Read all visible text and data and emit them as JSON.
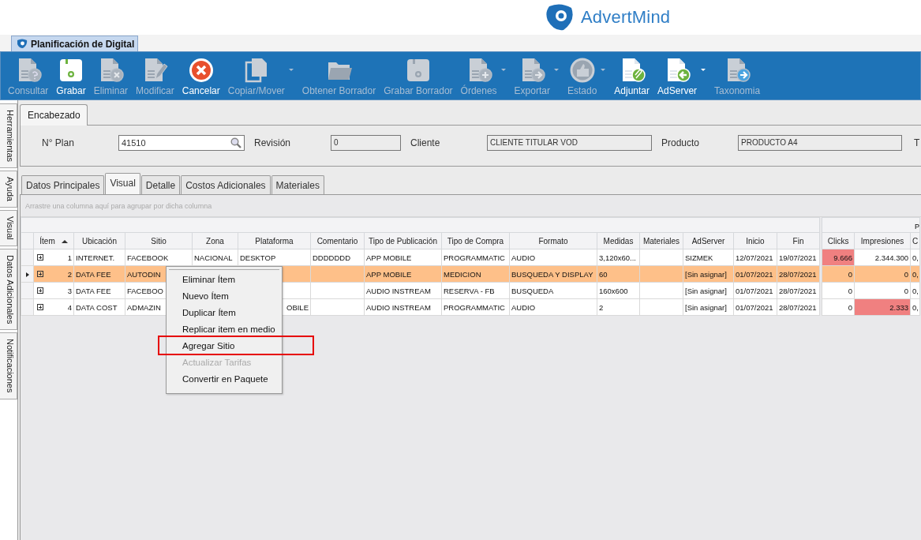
{
  "app": {
    "brand": "AdvertMind"
  },
  "document_tab": {
    "title": "Planificación de Digital",
    "selected": true
  },
  "toolbar": [
    {
      "label": "Consultar",
      "kind": "doc-question",
      "disabled": true,
      "dropdown": false
    },
    {
      "label": "Grabar",
      "kind": "floppy-green",
      "disabled": false,
      "dropdown": false
    },
    {
      "label": "Eliminar",
      "kind": "doc-x",
      "disabled": true,
      "dropdown": false
    },
    {
      "label": "Modificar",
      "kind": "doc-pencil",
      "disabled": true,
      "dropdown": false
    },
    {
      "label": "Cancelar",
      "kind": "cancel",
      "disabled": false,
      "dropdown": false
    },
    {
      "label": "Copiar/Mover",
      "kind": "copy",
      "disabled": true,
      "dropdown": true
    },
    {
      "label": "Obtener Borrador",
      "kind": "folder",
      "disabled": true,
      "dropdown": false
    },
    {
      "label": "Grabar Borrador",
      "kind": "floppy",
      "disabled": true,
      "dropdown": false
    },
    {
      "label": "Órdenes",
      "kind": "doc-plus",
      "disabled": true,
      "dropdown": true
    },
    {
      "label": "Exportar",
      "kind": "doc-arrow",
      "disabled": true,
      "dropdown": true
    },
    {
      "label": "Estado",
      "kind": "thumb",
      "disabled": true,
      "dropdown": true
    },
    {
      "label": "Adjuntar",
      "kind": "doc-clip",
      "disabled": false,
      "dropdown": false
    },
    {
      "label": "AdServer",
      "kind": "doc-back",
      "disabled": false,
      "dropdown": true
    },
    {
      "label": "Taxonomia",
      "kind": "doc-blue",
      "disabled": true,
      "dropdown": false
    }
  ],
  "side_tabs": [
    {
      "label": "Herramientas",
      "selected": false
    },
    {
      "label": "Ayuda",
      "selected": false
    },
    {
      "label": "Visual",
      "selected": false
    },
    {
      "label": "Datos Adicionales",
      "selected": false
    },
    {
      "label": "Notificaciones",
      "selected": false
    }
  ],
  "header": {
    "tab": "Encabezado",
    "fields": [
      {
        "label": "N° Plan",
        "value": "41510",
        "kind": "search"
      },
      {
        "label": "Revisión",
        "value": "0",
        "kind": "readonly"
      },
      {
        "label": "Cliente",
        "value": "CLIENTE TITULAR VOD",
        "kind": "readonly"
      },
      {
        "label": "Producto",
        "value": "PRODUCTO A4",
        "kind": "readonly"
      },
      {
        "label": "T",
        "kind": "cut"
      }
    ]
  },
  "tabs": [
    {
      "label": "Datos Principales",
      "selected": false
    },
    {
      "label": "Visual",
      "selected": true
    },
    {
      "label": "Detalle",
      "selected": false
    },
    {
      "label": "Costos Adicionales",
      "selected": false
    },
    {
      "label": "Materiales",
      "selected": false
    }
  ],
  "grid": {
    "group_hint": "Arrastre una columna aquí para agrupar por dicha columna",
    "band": "P",
    "columns": [
      "Ítem",
      "Ubicación",
      "Sitio",
      "Zona",
      "Plataforma",
      "Comentario",
      "Tipo de Publicación",
      "Tipo de Compra",
      "Formato",
      "Medidas",
      "Materiales",
      "AdServer",
      "Inicio",
      "Fin",
      "Clicks",
      "Impresiones",
      "C"
    ],
    "sorted_ascending": true,
    "rows": [
      {
        "selected": false,
        "cells": [
          "1",
          "INTERNET.",
          "FACEBOOK",
          "NACIONAL",
          "DESKTOP",
          "DDDDDDD",
          "APP MOBILE",
          "PROGRAMMATIC",
          "AUDIO",
          "3,120x60...",
          null,
          "SIZMEK",
          "12/07/2021",
          "19/07/2021",
          {
            "text": "9.666",
            "alert": true
          },
          "2.344.300",
          "0,"
        ]
      },
      {
        "selected": true,
        "cells": [
          "2",
          "DATA FEE",
          "AUTODIN",
          null,
          null,
          null,
          "APP MOBILE",
          "MEDICION",
          "BUSQUEDA Y DISPLAY",
          "60",
          null,
          "[Sin asignar]",
          "01/07/2021",
          "28/07/2021",
          "0",
          "0",
          "0,"
        ]
      },
      {
        "selected": false,
        "cells": [
          "3",
          "DATA FEE",
          "FACEBOO",
          null,
          null,
          null,
          "AUDIO INSTREAM",
          "RESERVA - FB",
          "BUSQUEDA",
          "160x600",
          null,
          "[Sin asignar]",
          "01/07/2021",
          "28/07/2021",
          "0",
          "0",
          "0,"
        ]
      },
      {
        "selected": false,
        "cells": [
          "4",
          "DATA COST",
          "ADMAZIN",
          null,
          {
            "text": "OBILE",
            "cut": true
          },
          null,
          "AUDIO INSTREAM",
          "PROGRAMMATIC",
          "AUDIO",
          "2",
          null,
          "[Sin asignar]",
          "01/07/2021",
          "28/07/2021",
          "0",
          {
            "text": "2.333",
            "alert": true
          },
          "0,"
        ]
      }
    ]
  },
  "context_menu": [
    {
      "label": "Eliminar Ítem",
      "disabled": false,
      "highlighted": false
    },
    {
      "label": "Nuevo Ítem",
      "disabled": false,
      "highlighted": false
    },
    {
      "label": "Duplicar Ítem",
      "disabled": false,
      "highlighted": false
    },
    {
      "label": "Replicar item en medio",
      "disabled": false,
      "highlighted": false
    },
    {
      "label": "Agregar Sitio",
      "disabled": false,
      "highlighted": true
    },
    {
      "label": "Actualizar Tarifas",
      "disabled": true,
      "highlighted": false
    },
    {
      "label": "Convertir en Paquete",
      "disabled": false,
      "highlighted": false
    }
  ]
}
